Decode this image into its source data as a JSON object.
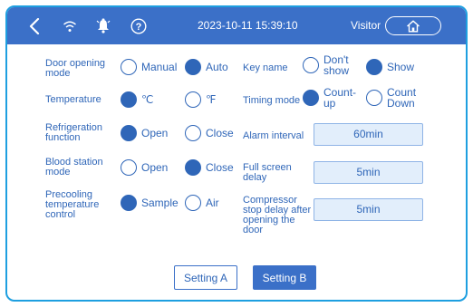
{
  "status_bar": {
    "datetime": "2023-10-11 15:39:10",
    "user": "Visitor",
    "icons": [
      "back-icon",
      "wifi-icon",
      "alarm-bell-icon",
      "help-icon",
      "home-icon"
    ]
  },
  "settings_left": [
    {
      "label_lines": [
        "Door opening",
        "mode"
      ],
      "options": [
        {
          "label": "Manual",
          "selected": false
        },
        {
          "label": "Auto",
          "selected": true
        }
      ]
    },
    {
      "label_lines": [
        "Temperature"
      ],
      "options": [
        {
          "label": "℃",
          "selected": true
        },
        {
          "label": "℉",
          "selected": false
        }
      ]
    },
    {
      "label_lines": [
        "Refrigeration",
        "function"
      ],
      "options": [
        {
          "label": "Open",
          "selected": true
        },
        {
          "label": "Close",
          "selected": false
        }
      ]
    },
    {
      "label_lines": [
        "Blood station",
        "mode"
      ],
      "options": [
        {
          "label": "Open",
          "selected": false
        },
        {
          "label": "Close",
          "selected": true
        }
      ]
    },
    {
      "label_lines": [
        "Precooling",
        "temperature",
        "control"
      ],
      "options": [
        {
          "label": "Sample",
          "selected": true
        },
        {
          "label": "Air",
          "selected": false
        }
      ]
    }
  ],
  "settings_right": {
    "key_name": {
      "label": "Key name",
      "options": [
        {
          "label_lines": [
            "Don't",
            "show"
          ],
          "selected": false
        },
        {
          "label_lines": [
            "Show"
          ],
          "selected": true
        }
      ]
    },
    "timing_mode": {
      "label": "Timing mode",
      "options": [
        {
          "label_lines": [
            "Count-",
            "up"
          ],
          "selected": true
        },
        {
          "label_lines": [
            "Count",
            "Down"
          ],
          "selected": false
        }
      ]
    },
    "alarm_interval": {
      "label_lines": [
        "Alarm interval"
      ],
      "value": "60min"
    },
    "full_screen_delay": {
      "label_lines": [
        "Full screen",
        "delay"
      ],
      "value": "5min"
    },
    "compressor_delay": {
      "label_lines": [
        "Compressor",
        "stop delay after",
        "opening the",
        "door"
      ],
      "value": "5min"
    }
  },
  "buttons": {
    "setting_a": "Setting A",
    "setting_b": "Setting B"
  },
  "colors": {
    "accent": "#3b70c8",
    "frame_border": "#1e9fe0",
    "text": "#2f66b8",
    "value_box": "#e2eefb"
  }
}
